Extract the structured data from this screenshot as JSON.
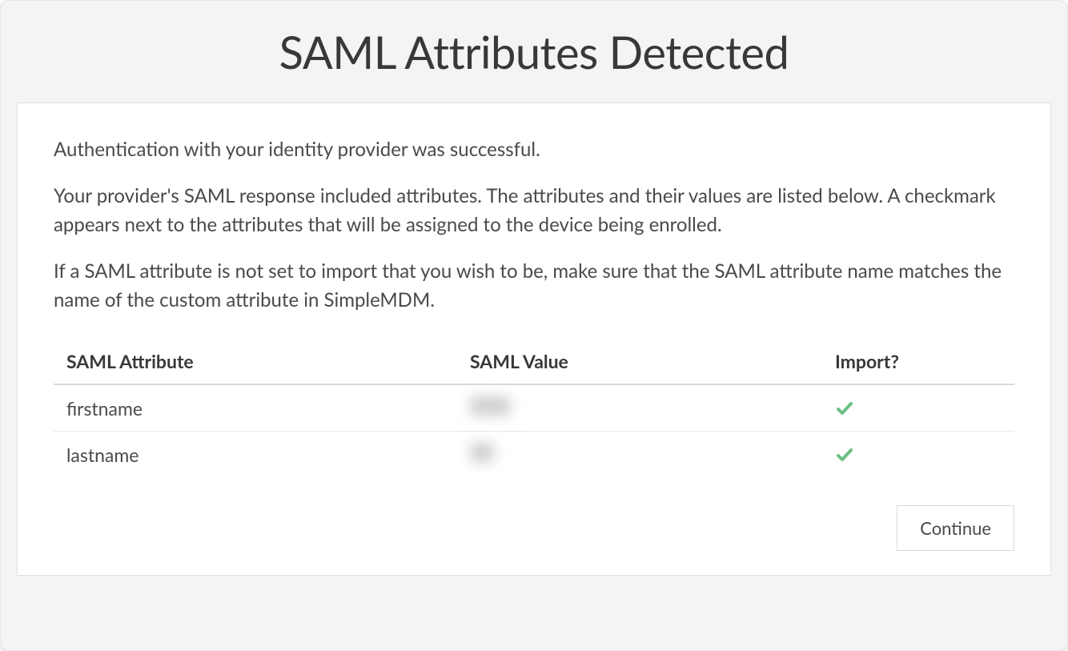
{
  "title": "SAML Attributes Detected",
  "paragraphs": {
    "p1": "Authentication with your identity provider was successful.",
    "p2": "Your provider's SAML response included attributes. The attributes and their values are listed below. A checkmark appears next to the attributes that will be assigned to the device being enrolled.",
    "p3": "If a SAML attribute is not set to import that you wish to be, make sure that the SAML attribute name matches the name of the custom attribute in SimpleMDM."
  },
  "table": {
    "headers": {
      "attribute": "SAML Attribute",
      "value": "SAML Value",
      "import": "Import?"
    },
    "rows": [
      {
        "attribute": "firstname",
        "value": "",
        "import": true
      },
      {
        "attribute": "lastname",
        "value": "",
        "import": true
      }
    ]
  },
  "buttons": {
    "continue": "Continue"
  },
  "colors": {
    "check_green": "#6cbf84"
  }
}
